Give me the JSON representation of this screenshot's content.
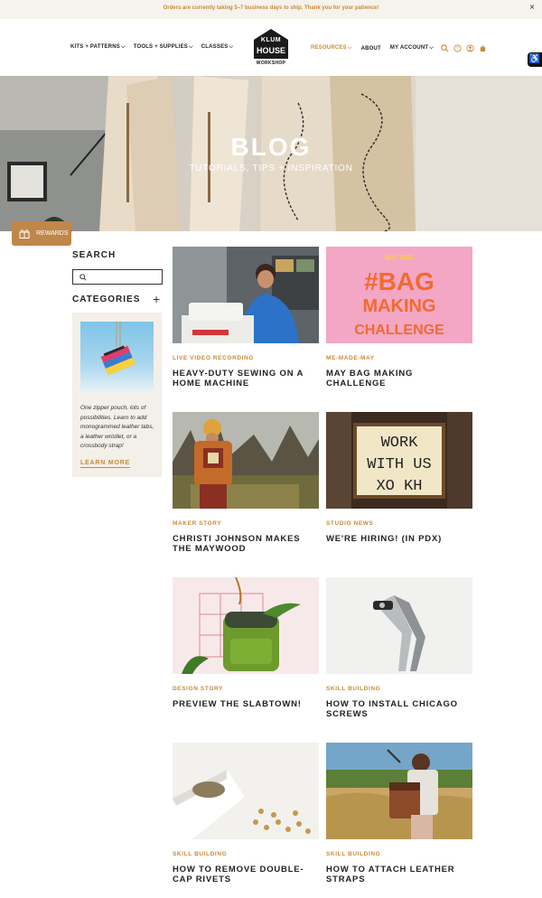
{
  "announcement": {
    "text": "Orders are currently taking 5–7 business days to ship. Thank you for your patience!",
    "close": "×"
  },
  "nav": {
    "left": [
      {
        "label": "KITS + PATTERNS"
      },
      {
        "label": "TOOLS + SUPPLIES"
      },
      {
        "label": "CLASSES"
      }
    ],
    "right": [
      {
        "label": "RESOURCES",
        "accent": true
      },
      {
        "label": "ABOUT"
      },
      {
        "label": "MY ACCOUNT"
      }
    ],
    "icons": [
      "search-icon",
      "help-icon",
      "account-icon",
      "cart-icon"
    ]
  },
  "logo": {
    "line1": "KLUM",
    "line2": "HOUSE",
    "line3": "WORKSHOP"
  },
  "accessibility": {
    "icon": "accessibility-icon",
    "glyph": "♿"
  },
  "hero": {
    "title": "BLOG",
    "subtitle": "TUTORIALS, TIPS + INSPIRATION"
  },
  "rewards": {
    "label": "REWARDS"
  },
  "sidebar": {
    "search_title": "SEARCH",
    "categories_title": "CATEGORIES",
    "plus": "+",
    "promo_text": "One zipper pouch, lots of possibilities. Learn to add monogrammed leather tabs, a leather wristlet, or a crossbody strap!",
    "promo_link": "LEARN MORE"
  },
  "posts": [
    {
      "category": "LIVE VIDEO RECORDING",
      "title": "HEAVY-DUTY SEWING ON A HOME MACHINE"
    },
    {
      "category": "ME-MADE-MAY",
      "title": "MAY BAG MAKING CHALLENGE",
      "image_text": {
        "top": "MAY 2021",
        "l1": "#BAG",
        "l2": "MAKING",
        "l3": "CHALLENGE"
      }
    },
    {
      "category": "MAKER STORY",
      "title": "CHRISTI JOHNSON MAKES THE MAYWOOD"
    },
    {
      "category": "STUDIO NEWS",
      "title": "WE'RE HIRING! (IN PDX)",
      "image_text": {
        "l1": "WORK",
        "l2": "WITH US",
        "l3": "XO KH"
      }
    },
    {
      "category": "DESIGN STORY",
      "title": "PREVIEW THE SLABTOWN!"
    },
    {
      "category": "SKILL BUILDING",
      "title": "HOW TO INSTALL CHICAGO SCREWS"
    },
    {
      "category": "SKILL BUILDING",
      "title": "HOW TO REMOVE DOUBLE-CAP RIVETS"
    },
    {
      "category": "SKILL BUILDING",
      "title": "HOW TO ATTACH LEATHER STRAPS"
    }
  ],
  "colors": {
    "accent": "#c88a3a",
    "announce_bg": "#f6f2ec",
    "promo_bg": "#f3efe9",
    "challenge_pink": "#f4a7c4",
    "challenge_orange": "#f26a2e"
  }
}
